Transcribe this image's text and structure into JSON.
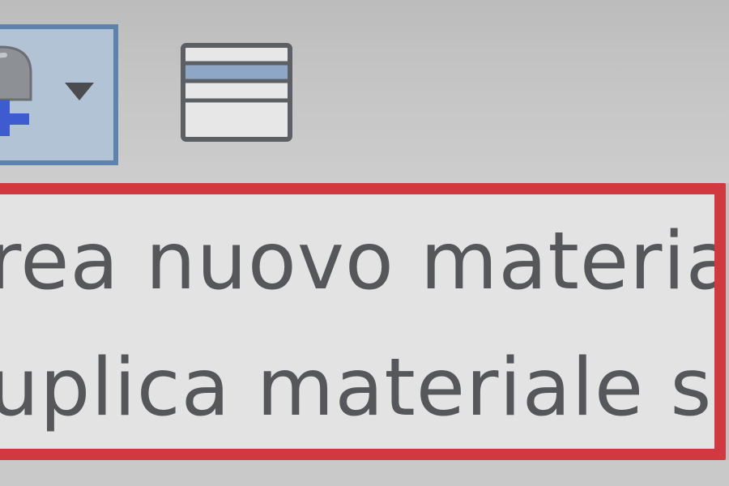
{
  "toolbar": {
    "add_material_icon": "material-add-icon",
    "dropdown_icon": "chevron-down-icon",
    "table_view_icon": "table-view-icon"
  },
  "menu": {
    "items": [
      {
        "label": "rea nuovo materiale"
      },
      {
        "label": "uplica materiale selez"
      }
    ]
  },
  "colors": {
    "menu_border": "#d0393f",
    "menu_background": "#e3e3e3",
    "selected_button_border": "#5d83ad",
    "selected_button_fill": "#b1c3d4",
    "plus_blue": "#3e5cd0"
  }
}
